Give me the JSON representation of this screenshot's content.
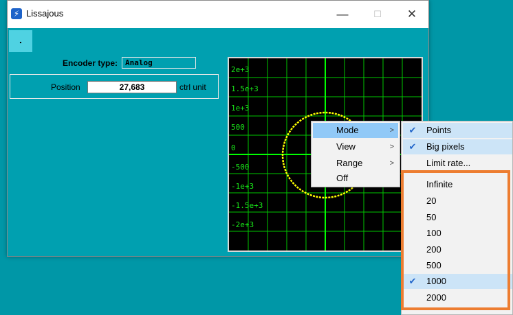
{
  "window": {
    "title": "Lissajous",
    "minimize": "—",
    "maximize": "☐",
    "close": "✕"
  },
  "toolbar": {
    "dot_button": "."
  },
  "encoder": {
    "label": "Encoder type:",
    "value": "Analog"
  },
  "position": {
    "label": "Position",
    "value": "27,683",
    "unit": "ctrl unit"
  },
  "plot": {
    "y_labels": [
      "2e+3",
      "1.5e+3",
      "1e+3",
      "500",
      "0",
      "-500",
      "-1e+3",
      "-1.5e+3",
      "-2e+3"
    ],
    "grid_color": "#00c800",
    "trace_color": "#ffff00"
  },
  "context_menu": {
    "items": [
      {
        "label": "Mode",
        "submenu": true,
        "selected": true
      },
      {
        "label": "View",
        "submenu": true
      },
      {
        "label": "Range",
        "submenu": true
      },
      {
        "label": "Off",
        "submenu": false
      }
    ]
  },
  "mode_submenu": {
    "items": [
      {
        "label": "Points",
        "checked": true
      },
      {
        "label": "Big pixels",
        "checked": true
      },
      {
        "label": "Limit rate...",
        "checked": false
      },
      {
        "label": "Infinite",
        "checked": false
      },
      {
        "label": "20",
        "checked": false
      },
      {
        "label": "50",
        "checked": false
      },
      {
        "label": "100",
        "checked": false
      },
      {
        "label": "200",
        "checked": false
      },
      {
        "label": "500",
        "checked": false
      },
      {
        "label": "1000",
        "checked": true
      },
      {
        "label": "2000",
        "checked": false
      }
    ]
  },
  "colors": {
    "highlight_border": "#ed7d31",
    "accent": "#0097a7"
  }
}
